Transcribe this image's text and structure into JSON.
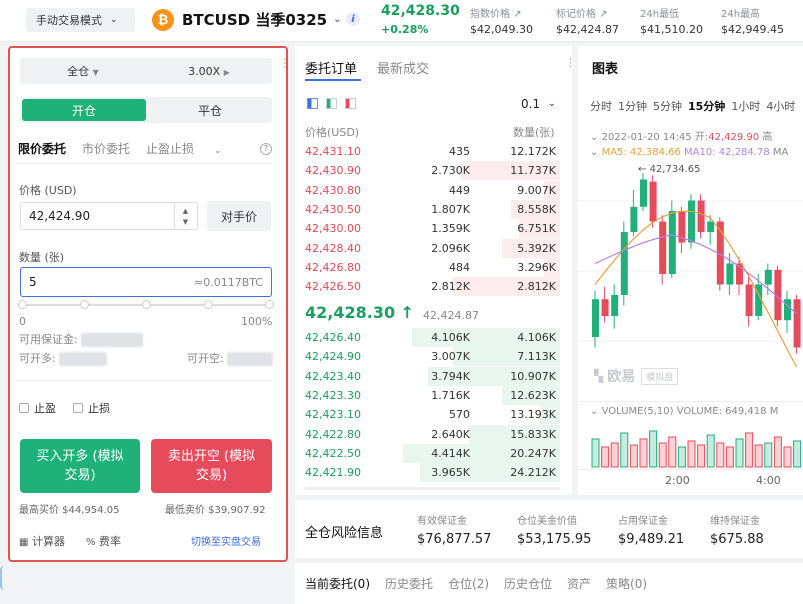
{
  "header": {
    "mode": "手动交易模式",
    "coin_letter": "₿",
    "symbol": "BTCUSD 当季0325",
    "info": "i",
    "last_price": "42,428.30",
    "change": "+0.28%",
    "stats": [
      {
        "label": "指数价格",
        "value": "$42,049.30"
      },
      {
        "label": "标记价格",
        "value": "$42,424.87"
      },
      {
        "label": "24h最低",
        "value": "$41,510.20"
      },
      {
        "label": "24h最高",
        "value": "$42,949.45"
      }
    ]
  },
  "order_panel": {
    "margin_mode": "全仓",
    "leverage": "3.00X",
    "open_tab": "开仓",
    "close_tab": "平仓",
    "order_types": [
      "限价委托",
      "市价委托",
      "止盈止损"
    ],
    "price_label": "价格 (USD)",
    "price_value": "42,424.90",
    "opponent_price": "对手价",
    "qty_label": "数量 (张)",
    "qty_value": "5",
    "qty_btc": "≈0.0117BTC",
    "slider_min": "0",
    "slider_max": "100%",
    "available_margin": "可用保证金:",
    "can_open_long": "可开多:",
    "can_open_short": "可开空:",
    "take_profit": "止盈",
    "stop_loss": "止损",
    "buy_label_1": "买入开多 (模拟",
    "buy_label_2": "交易)",
    "sell_label_1": "卖出开空 (模拟",
    "sell_label_2": "交易)",
    "max_buy": "最高买价 $44,954.05",
    "min_sell": "最低卖价 $39,907.92",
    "calculator": "计算器",
    "fee": "费率",
    "switch_real": "切换至实盘交易"
  },
  "order_book": {
    "tabs": [
      "委托订单",
      "最新成交"
    ],
    "precision": "0.1",
    "col_price": "价格(USD)",
    "col_qty": "数量(张)",
    "asks": [
      {
        "price": "42,431.10",
        "qty": "435",
        "total": "12.172K",
        "depth": 0.0
      },
      {
        "price": "42,430.90",
        "qty": "2.730K",
        "total": "11.737K",
        "depth": 0.6
      },
      {
        "price": "42,430.80",
        "qty": "449",
        "total": "9.007K",
        "depth": 0.1
      },
      {
        "price": "42,430.50",
        "qty": "1.807K",
        "total": "8.558K",
        "depth": 0.3
      },
      {
        "price": "42,430.00",
        "qty": "1.359K",
        "total": "6.751K",
        "depth": 0.25
      },
      {
        "price": "42,428.40",
        "qty": "2.096K",
        "total": "5.392K",
        "depth": 0.35
      },
      {
        "price": "42,426.80",
        "qty": "484",
        "total": "3.296K",
        "depth": 0.1
      },
      {
        "price": "42,426.50",
        "qty": "2.812K",
        "total": "2.812K",
        "depth": 0.65
      }
    ],
    "mid_price": "42,428.30 ↑",
    "mark_price": "42,424.87",
    "bids": [
      {
        "price": "42,426.40",
        "qty": "4.106K",
        "total": "4.106K",
        "depth": 0.9
      },
      {
        "price": "42,424.90",
        "qty": "3.007K",
        "total": "7.113K",
        "depth": 0.65
      },
      {
        "price": "42,423.40",
        "qty": "3.794K",
        "total": "10.907K",
        "depth": 0.8
      },
      {
        "price": "42,423.30",
        "qty": "1.716K",
        "total": "12.623K",
        "depth": 0.35
      },
      {
        "price": "42,423.10",
        "qty": "570",
        "total": "13.193K",
        "depth": 0.12
      },
      {
        "price": "42,422.80",
        "qty": "2.640K",
        "total": "15.833K",
        "depth": 0.55
      },
      {
        "price": "42,422.50",
        "qty": "4.414K",
        "total": "20.247K",
        "depth": 0.95
      },
      {
        "price": "42,421.90",
        "qty": "3.965K",
        "total": "24.212K",
        "depth": 0.85
      }
    ]
  },
  "chart": {
    "title": "图表",
    "intervals": [
      "分时",
      "1分钟",
      "5分钟",
      "15分钟",
      "1小时",
      "4小时"
    ],
    "ohlc_date": "2022-01-20 14:45",
    "ohlc_open_label": "开:",
    "ohlc_open": "42,429.90",
    "ohlc_more": "高",
    "ma5": "MA5: 42,384.66",
    "ma10": "MA10: 42,284.78",
    "ma_more": "MA",
    "high_marker": "42,734.65",
    "watermark": "欧易",
    "watermark_tag": "模拟盘",
    "volume_label": "VOLUME(5,10)",
    "volume_value": "VOLUME: 649,418",
    "volume_more": "M",
    "time_ticks": [
      "2:00",
      "4:00"
    ],
    "colors": {
      "up": "#1fb17a",
      "down": "#e64b5c",
      "ma5": "#e6a23c",
      "ma10": "#b37feb"
    }
  },
  "risk": {
    "title": "全仓风险信息",
    "items": [
      {
        "label": "有效保证金",
        "value": "$76,877.57"
      },
      {
        "label": "仓位美金价值",
        "value": "$53,175.95"
      },
      {
        "label": "占用保证金",
        "value": "$9,489.21"
      },
      {
        "label": "维持保证金",
        "value": "$675.88"
      }
    ]
  },
  "bottom_tabs": [
    "当前委托(0)",
    "历史委托",
    "仓位(2)",
    "历史仓位",
    "资产",
    "策略(0)"
  ]
}
